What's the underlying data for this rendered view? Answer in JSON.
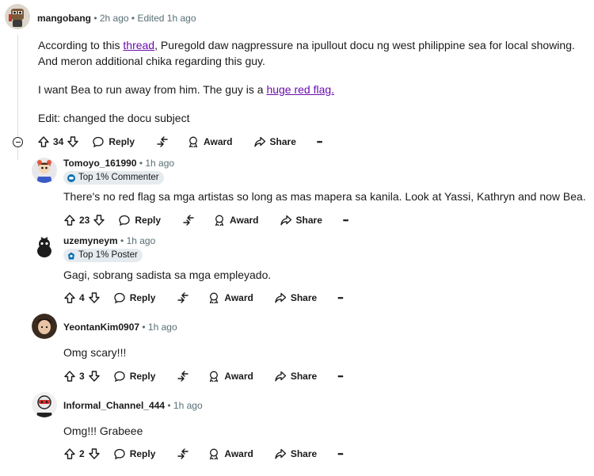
{
  "colors": {
    "link": "#6a0dad",
    "meta": "#576f76",
    "text": "#1a1a1b",
    "badge_bg": "#e5ebee"
  },
  "main_comment": {
    "user": "mangobang",
    "meta": " • 2h ago • Edited 1h ago",
    "line1_prefix": "According to this ",
    "line1_link": "thread",
    "line1_suffix": ", Puregold daw nagpressure na ipullout docu ng west philippine sea for local showing.",
    "line2": "And meron additional chika regarding this guy.",
    "line3_prefix": "I want Bea to run away from him. The guy is a ",
    "line3_link": "huge red flag.",
    "line4": "Edit: changed the docu subject",
    "votes": "34"
  },
  "actions": {
    "reply": "Reply",
    "award": "Award",
    "share": "Share",
    "more": "•••"
  },
  "replies": [
    {
      "user": "Tomoyo_161990",
      "meta": " • 1h ago",
      "badge": "Top 1% Commenter",
      "badge_icon": "comment-badge-icon",
      "text": "There's no red flag sa mga artistas so long as mas mapera sa kanila. Look at Yassi, Kathryn and now Bea.",
      "votes": "23"
    },
    {
      "user": "uzemyneym",
      "meta": " • 1h ago",
      "badge": "Top 1% Poster",
      "badge_icon": "poster-badge-icon",
      "text": "Gagi, sobrang sadista sa mga empleyado.",
      "votes": "4"
    },
    {
      "user": "YeontanKim0907",
      "meta": " • 1h ago",
      "text": "Omg scary!!!",
      "votes": "3"
    },
    {
      "user": "Informal_Channel_444",
      "meta": " • 1h ago",
      "text": "Omg!!! Grabeee",
      "votes": "2"
    }
  ]
}
